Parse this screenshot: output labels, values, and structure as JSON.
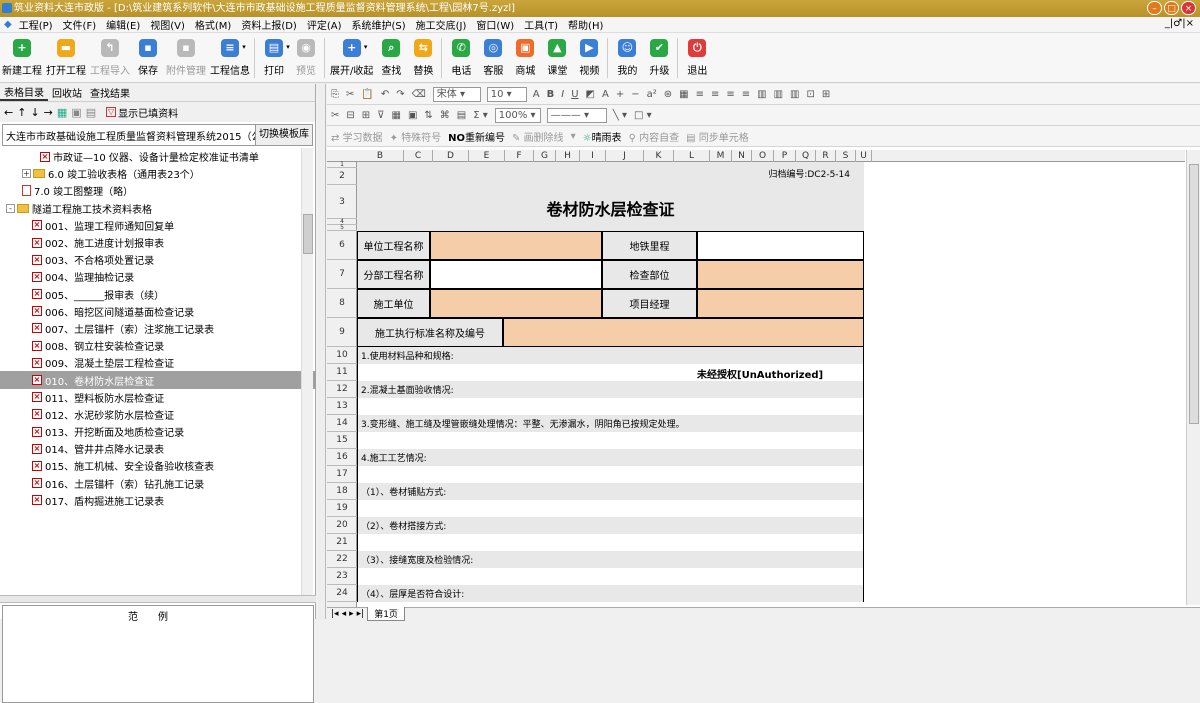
{
  "window": {
    "title": "筑业资料大连市政版 - [D:\\筑业建筑系列软件\\大连市市政基础设施工程质量监督资料管理系统\\工程\\园林7号.zyzl]"
  },
  "menu": [
    "工程(P)",
    "文件(F)",
    "编辑(E)",
    "视图(V)",
    "格式(M)",
    "资料上报(D)",
    "评定(A)",
    "系统维护(S)",
    "施工交底(J)",
    "窗口(W)",
    "工具(T)",
    "帮助(H)"
  ],
  "menu_mdi": "_|♂|×",
  "toolbar": [
    {
      "label": "新建工程",
      "color": "#2aa845",
      "glyph": "+"
    },
    {
      "label": "打开工程",
      "color": "#f0a818",
      "glyph": "▬"
    },
    {
      "label": "工程导入",
      "color": "#b9b9b9",
      "glyph": "↰",
      "disabled": true
    },
    {
      "label": "保存",
      "color": "#3b7ed6",
      "glyph": "▪"
    },
    {
      "label": "附件管理",
      "color": "#b9b9b9",
      "glyph": "▪",
      "disabled": true
    },
    {
      "label": "工程信息",
      "color": "#3b7ed6",
      "glyph": "≡",
      "caret": true
    },
    {
      "label": "打印",
      "color": "#3b7ed6",
      "glyph": "▤",
      "caret": true,
      "sep": true
    },
    {
      "label": "预览",
      "color": "#b9b9b9",
      "glyph": "◉",
      "disabled": true
    },
    {
      "label": "展开/收起",
      "color": "#3b7ed6",
      "glyph": "+",
      "caret": true,
      "sep": true
    },
    {
      "label": "查找",
      "color": "#2aa845",
      "glyph": "⌕"
    },
    {
      "label": "替换",
      "color": "#f0a818",
      "glyph": "⇆"
    },
    {
      "label": "电话",
      "color": "#2aa845",
      "glyph": "✆",
      "sep": true
    },
    {
      "label": "客服",
      "color": "#3b7ed6",
      "glyph": "◎"
    },
    {
      "label": "商城",
      "color": "#f06a2a",
      "glyph": "▣"
    },
    {
      "label": "课堂",
      "color": "#2aa845",
      "glyph": "▲"
    },
    {
      "label": "视频",
      "color": "#3b7ed6",
      "glyph": "▶"
    },
    {
      "label": "我的",
      "color": "#3b7ed6",
      "glyph": "☺",
      "sep": true
    },
    {
      "label": "升级",
      "color": "#2aa845",
      "glyph": "✔"
    },
    {
      "label": "退出",
      "color": "#e03a3a",
      "glyph": "⏻",
      "sep": true
    }
  ],
  "left": {
    "tabs": [
      "表格目录",
      "回收站",
      "查找结果"
    ],
    "show_filled": "显示已填资料",
    "template_value": "大连市市政基础设施工程质量监督资料管理系统2015（公",
    "switch_template": "切换模板库",
    "tree": [
      {
        "indent": 40,
        "type": "x",
        "text": "市政证—10 仪器、设备计量检定校准证书清单"
      },
      {
        "indent": 22,
        "type": "folder",
        "pm": "+",
        "text": "6.0 竣工验收表格（通用表23个）"
      },
      {
        "indent": 22,
        "type": "doc",
        "text": "7.0 竣工图整理（略）"
      },
      {
        "indent": 6,
        "type": "folder",
        "pm": "-",
        "text": "隧道工程施工技术资料表格"
      },
      {
        "indent": 32,
        "type": "x",
        "text": "001、监理工程师通知回复单"
      },
      {
        "indent": 32,
        "type": "x",
        "text": "002、施工进度计划报审表"
      },
      {
        "indent": 32,
        "type": "x",
        "text": "003、不合格项处置记录"
      },
      {
        "indent": 32,
        "type": "x",
        "text": "004、监理抽检记录"
      },
      {
        "indent": 32,
        "type": "x",
        "text": "005、______报审表（续）"
      },
      {
        "indent": 32,
        "type": "x",
        "text": "006、暗挖区间隧道基面检查记录"
      },
      {
        "indent": 32,
        "type": "x",
        "text": "007、土层锚杆（索）注浆施工记录表"
      },
      {
        "indent": 32,
        "type": "x",
        "text": "008、钢立柱安装检查记录"
      },
      {
        "indent": 32,
        "type": "x",
        "text": "009、混凝土垫层工程检查证"
      },
      {
        "indent": 32,
        "type": "x",
        "text": "010、卷材防水层检查证",
        "selected": true
      },
      {
        "indent": 32,
        "type": "x",
        "text": "011、塑料板防水层检查证"
      },
      {
        "indent": 32,
        "type": "x",
        "text": "012、水泥砂浆防水层检查证"
      },
      {
        "indent": 32,
        "type": "x",
        "text": "013、开挖断面及地质检查记录"
      },
      {
        "indent": 32,
        "type": "x",
        "text": "014、管井井点降水记录表"
      },
      {
        "indent": 32,
        "type": "x",
        "text": "015、施工机械、安全设备验收核查表"
      },
      {
        "indent": 32,
        "type": "x",
        "text": "016、土层锚杆（索）钻孔施工记录"
      },
      {
        "indent": 32,
        "type": "x",
        "text": "017、盾构掘进施工记录表"
      }
    ],
    "example_label": "范例"
  },
  "format_bars": {
    "row1": {
      "font": "宋体",
      "size": "10",
      "zoom": "100%"
    },
    "row2": {},
    "row3": {
      "items": [
        "学习数据",
        "特殊符号",
        "重新编号",
        "画删除线",
        "晴雨表",
        "内容自查",
        "同步单元格"
      ],
      "no_prefix": "NO"
    }
  },
  "sheet": {
    "columns": [
      "B",
      "C",
      "D",
      "E",
      "F",
      "G",
      "H",
      "I",
      "J",
      "K",
      "L",
      "M",
      "N",
      "O",
      "P",
      "Q",
      "R",
      "S",
      "U"
    ],
    "rows": [
      "1",
      "2",
      "3",
      "4",
      "5",
      "6",
      "7",
      "8",
      "9",
      "10",
      "11",
      "12",
      "13",
      "14",
      "15",
      "16",
      "17",
      "18",
      "19",
      "20",
      "21",
      "22",
      "23",
      "24"
    ],
    "archive_no": "归档编号:DC2-5-14",
    "title": "卷材防水层检查证",
    "labels": {
      "unit_project": "单位工程名称",
      "metro_mileage": "地铁里程",
      "sub_project": "分部工程名称",
      "check_part": "检查部位",
      "construction_unit": "施工单位",
      "project_manager": "项目经理",
      "standard": "施工执行标准名称及编号"
    },
    "lines": {
      "r10": "1.使用材料品种和规格:",
      "r12": "2.混凝土基面验收情况:",
      "r14": "3.变形缝、施工缝及埋管嵌缝处理情况：平整、无渗漏水，阴阳角已按规定处理。",
      "r16": "4.施工工艺情况:",
      "r18": "（1）、卷材铺贴方式:",
      "r20": "（2）、卷材搭接方式:",
      "r22": "（3）、接缝宽度及检验情况:",
      "r24": "（4）、层厚是否符合设计:"
    },
    "watermark": "未经授权[UnAuthorized]"
  },
  "sheet_tab": "第1页"
}
